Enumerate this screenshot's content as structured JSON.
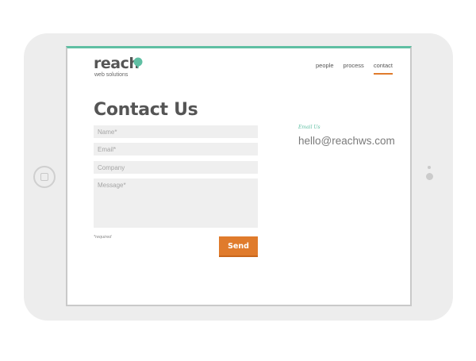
{
  "logo": {
    "word": "reach",
    "subtitle": "web solutions",
    "accent_color": "#5fbfa3"
  },
  "nav": {
    "items": [
      {
        "label": "people"
      },
      {
        "label": "process"
      },
      {
        "label": "contact",
        "active": true
      }
    ],
    "active_color": "#e07b2c"
  },
  "page": {
    "title": "Contact Us"
  },
  "form": {
    "name_placeholder": "Name*",
    "email_placeholder": "Email*",
    "company_placeholder": "Company",
    "message_placeholder": "Message*",
    "required_note": "*required",
    "send_label": "Send",
    "send_color": "#e07b2c"
  },
  "contact": {
    "email_label": "Email Us",
    "email_value": "hello@reachws.com"
  }
}
